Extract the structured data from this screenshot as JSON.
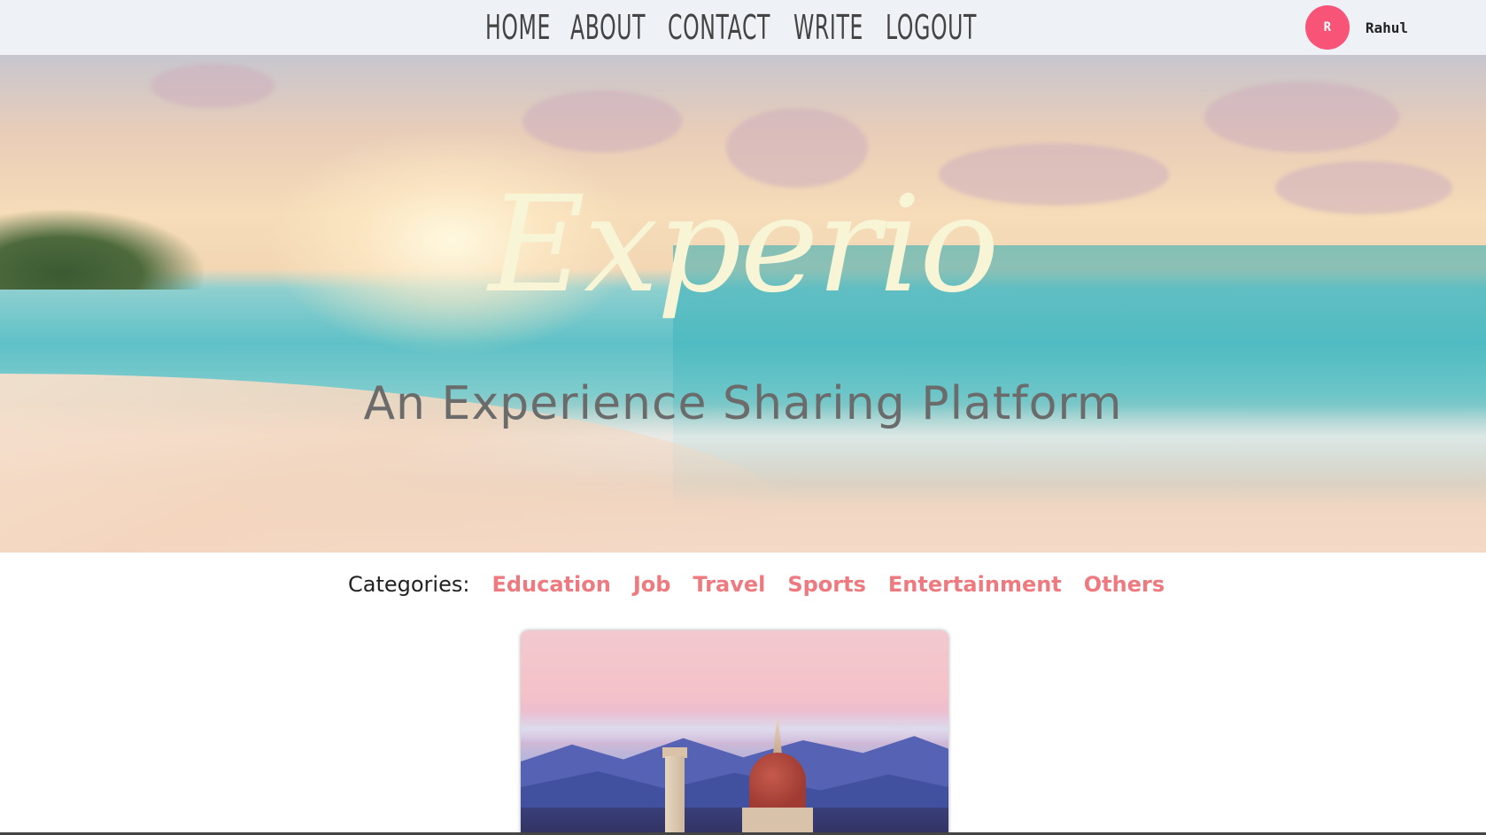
{
  "nav": {
    "items": [
      {
        "label": "HOME"
      },
      {
        "label": "ABOUT"
      },
      {
        "label": "CONTACT"
      },
      {
        "label": "WRITE"
      },
      {
        "label": "LOGOUT"
      }
    ]
  },
  "user": {
    "avatar_initial": "R",
    "name": "Rahul"
  },
  "hero": {
    "title": "Experio",
    "subtitle": "An Experience Sharing Platform"
  },
  "categories": {
    "label": "Categories:",
    "items": [
      {
        "label": "Education"
      },
      {
        "label": "Job"
      },
      {
        "label": "Travel"
      },
      {
        "label": "Sports"
      },
      {
        "label": "Entertainment"
      },
      {
        "label": "Others"
      }
    ]
  },
  "colors": {
    "accent": "#ee7a80",
    "avatar": "#f75478",
    "title": "#f7f5d6",
    "topbar": "#eef2f6"
  }
}
